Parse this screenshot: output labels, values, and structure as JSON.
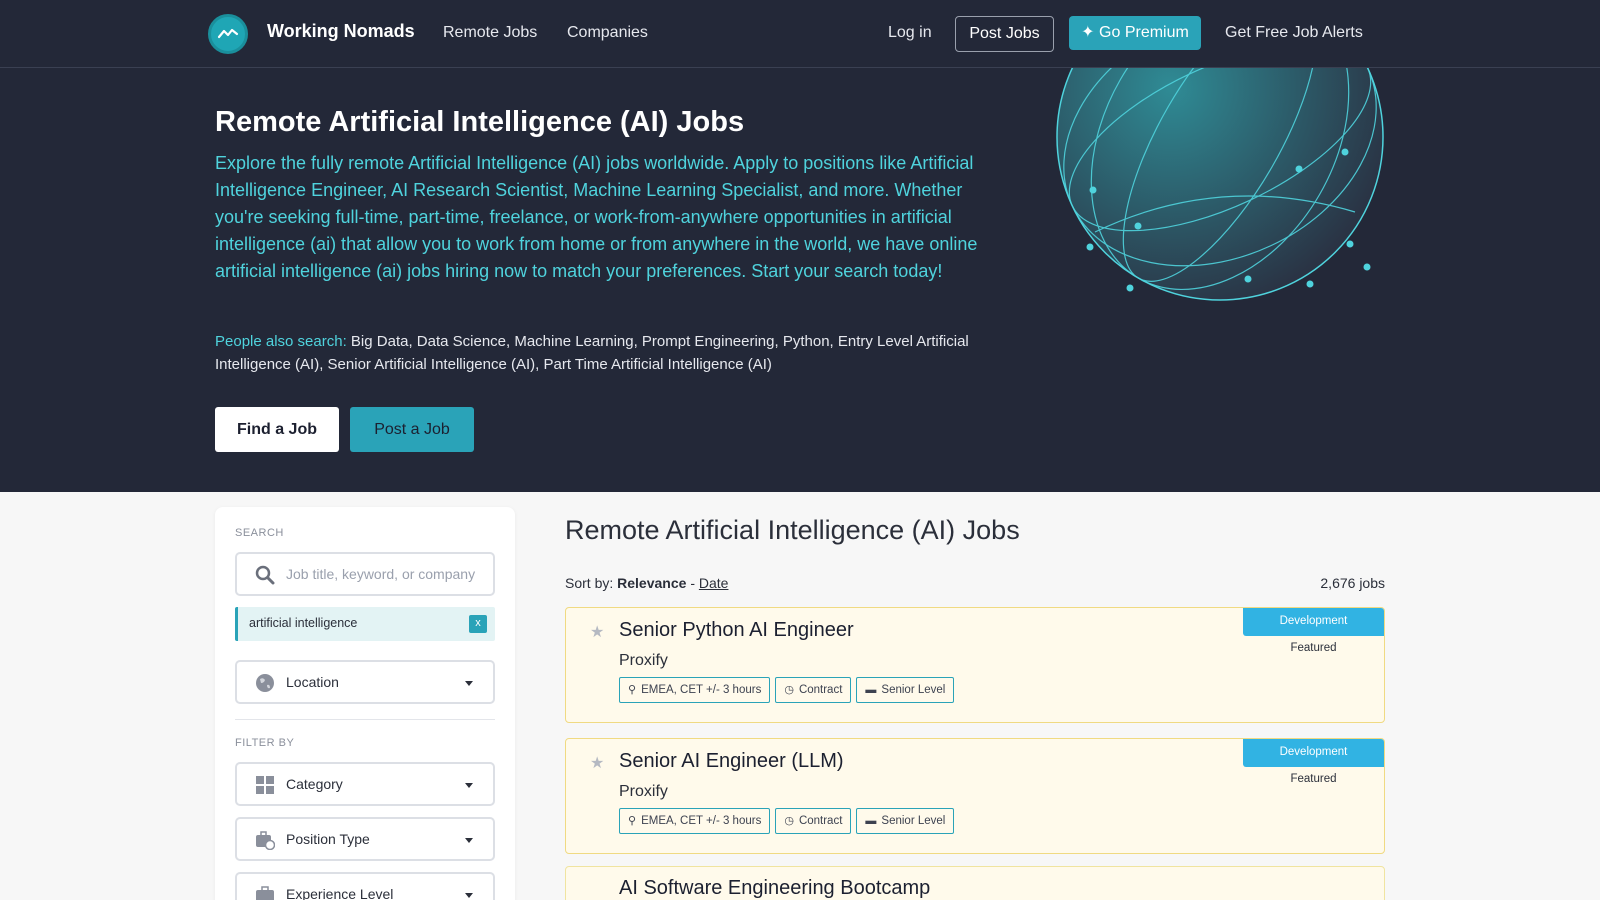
{
  "nav": {
    "brand": "Working Nomads",
    "links": [
      "Remote Jobs",
      "Companies"
    ],
    "login": "Log in",
    "post_jobs": "Post Jobs",
    "premium": "✦ Go Premium",
    "alerts": "Get Free Job Alerts"
  },
  "hero": {
    "title": "Remote Artificial Intelligence (AI) Jobs",
    "description": "Explore the fully remote Artificial Intelligence (AI) jobs worldwide. Apply to positions like Artificial Intelligence Engineer, AI Research Scientist, Machine Learning Specialist, and more. Whether you're seeking full-time, part-time, freelance, or work-from-anywhere opportunities in artificial intelligence (ai) that allow you to work from home or from anywhere in the world, we have online artificial intelligence (ai) jobs hiring now to match your preferences. Start your search today!",
    "also_label": "People also search:",
    "also_text": "Big Data, Data Science, Machine Learning, Prompt Engineering, Python, Entry Level Artificial Intelligence (AI), Senior Artificial Intelligence (AI), Part Time Artificial Intelligence (AI)",
    "find_button": "Find a Job",
    "post_button": "Post a Job"
  },
  "sidebar": {
    "search_label": "SEARCH",
    "search_placeholder": "Job title, keyword, or company",
    "active_filter": "artificial intelligence",
    "remove_filter": "x",
    "location": "Location",
    "filter_label": "FILTER BY",
    "category": "Category",
    "position_type": "Position Type",
    "experience_level": "Experience Level"
  },
  "main": {
    "title": "Remote Artificial Intelligence (AI) Jobs",
    "sort_label": "Sort by:",
    "sort_relevance": "Relevance",
    "sort_sep": "-",
    "sort_date": "Date",
    "job_count": "2,676 jobs"
  },
  "jobs": [
    {
      "title": "Senior Python AI Engineer",
      "company": "Proxify",
      "location": "EMEA, CET +/- 3 hours",
      "type": "Contract",
      "level": "Senior Level",
      "category": "Development",
      "badge": "Featured"
    },
    {
      "title": "Senior AI Engineer (LLM)",
      "company": "Proxify",
      "location": "EMEA, CET +/- 3 hours",
      "type": "Contract",
      "level": "Senior Level",
      "category": "Development",
      "badge": "Featured"
    },
    {
      "title": "AI Software Engineering Bootcamp"
    }
  ],
  "colors": {
    "nav_bg": "#232838",
    "accent": "#2aa3b8",
    "hero_text": "#4fd3dd",
    "category_badge": "#31b3e3",
    "featured_card_bg": "#fffaeb",
    "featured_card_border": "#f0da82"
  },
  "icons": [
    "logo-icon",
    "globe-illustration",
    "search-icon",
    "globe-icon",
    "category-grid-icon",
    "position-type-icon",
    "experience-icon",
    "star-icon",
    "location-pin-icon",
    "clock-icon",
    "briefcase-icon",
    "caret-down-icon"
  ]
}
